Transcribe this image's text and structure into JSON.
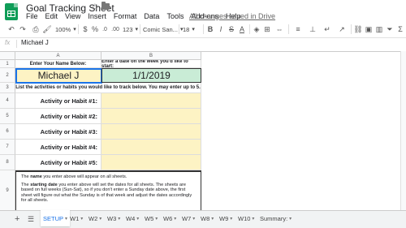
{
  "app": {
    "doc_title": "Goal Tracking Sheet",
    "menu": [
      "File",
      "Edit",
      "View",
      "Insert",
      "Format",
      "Data",
      "Tools",
      "Add-ons",
      "Help"
    ],
    "saved_status": "All changes saved in Drive"
  },
  "toolbar": {
    "zoom": "100%",
    "currency": "$",
    "percent": "%",
    "decimal_less": ".0",
    "decimal_more": ".00",
    "number_format": "123",
    "font": "Comic San...",
    "font_size": "18",
    "bold": "B",
    "italic": "I",
    "strike": "S",
    "text_color": "A"
  },
  "formula_bar": {
    "fx": "fx",
    "value": "Michael J"
  },
  "grid": {
    "columns": [
      "A",
      "B"
    ],
    "rows": [
      "1",
      "2",
      "3",
      "4",
      "5",
      "6",
      "7",
      "8",
      "9"
    ],
    "header_name": "Enter Your Name Below:",
    "header_date": "Enter a date on the week you'd like to start:",
    "name_value": "Michael J",
    "date_value": "1/1/2019",
    "instructions": "List the activities or habits you would like to track below. You may enter up to 5.",
    "activities": [
      "Activity or Habit #1:",
      "Activity or Habit #2:",
      "Activity or Habit #3:",
      "Activity or Habit #4:",
      "Activity or Habit #5:"
    ],
    "note1_bold": "name",
    "note1_pre": "The ",
    "note1_post": " you enter above will appear on all sheets.",
    "note2_pre": "The ",
    "note2_bold": "starting date",
    "note2_post": " you enter above will set the dates for all sheets. The sheets are based on full weeks (Sun-Sat), so if you don't enter a Sunday date above, the first sheet will figure out what the Sunday is of that week and adjust the dates accordingly for all sheets."
  },
  "sheets": {
    "tabs": [
      "SETUP",
      "W1",
      "W2",
      "W3",
      "W4",
      "W5",
      "W6",
      "W7",
      "W8",
      "W9",
      "W10",
      "Summary:"
    ],
    "active": "SETUP"
  },
  "colors": {
    "name_fill": "#fdf3c4",
    "date_fill": "#c9ecd6",
    "selection": "#1a73e8",
    "brand": "#0f9d58"
  }
}
